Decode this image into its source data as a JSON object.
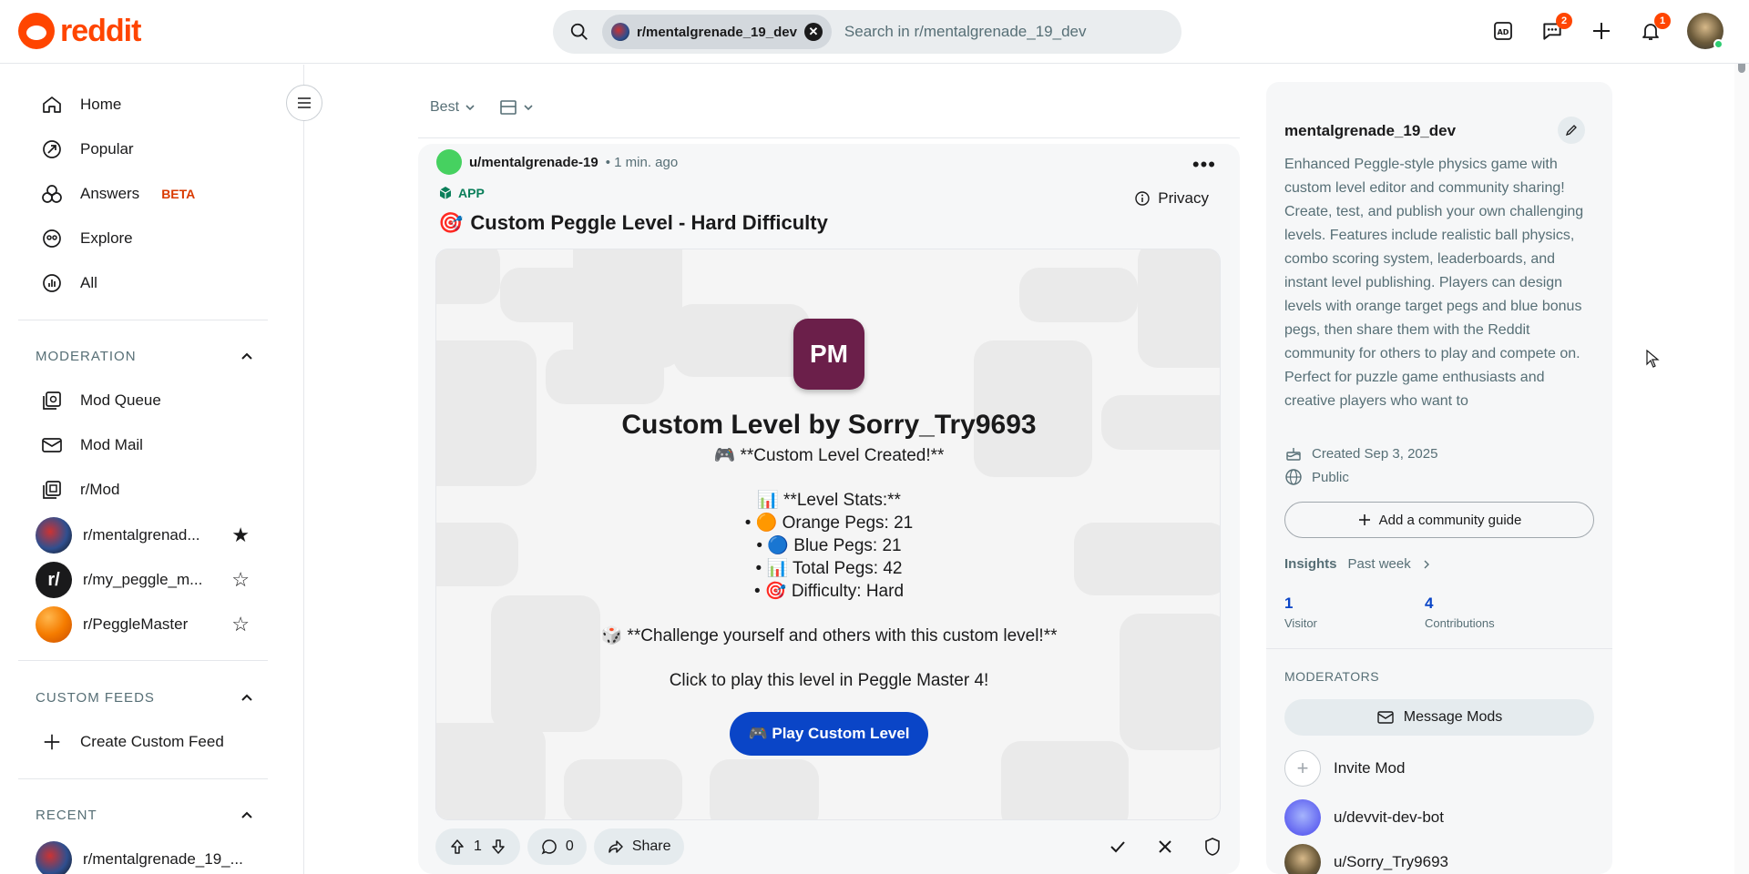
{
  "app": {
    "logo_text": "reddit",
    "brand_color": "#ff4500"
  },
  "search": {
    "chip_label": "r/mentalgrenade_19_dev",
    "placeholder": "Search in r/mentalgrenade_19_dev"
  },
  "header": {
    "chat_badge": "2",
    "notif_badge": "1",
    "icons": [
      "advertise-icon",
      "chat-icon",
      "create-icon",
      "notification-icon"
    ]
  },
  "sidebar": {
    "nav": [
      {
        "label": "Home",
        "icon": "home-icon"
      },
      {
        "label": "Popular",
        "icon": "popular-icon"
      },
      {
        "label": "Answers",
        "icon": "answers-icon",
        "tag": "BETA"
      },
      {
        "label": "Explore",
        "icon": "explore-icon"
      },
      {
        "label": "All",
        "icon": "all-icon"
      }
    ],
    "moderation_title": "MODERATION",
    "moderation": [
      {
        "label": "Mod Queue",
        "icon": "mod-queue-icon"
      },
      {
        "label": "Mod Mail",
        "icon": "mod-mail-icon"
      },
      {
        "label": "r/Mod",
        "icon": "mod-icon"
      }
    ],
    "communities": [
      {
        "label": "r/mentalgrenad...",
        "starred": true
      },
      {
        "label": "r/my_peggle_m...",
        "starred": false
      },
      {
        "label": "r/PeggleMaster",
        "starred": false
      }
    ],
    "custom_feeds_title": "CUSTOM FEEDS",
    "create_feed": "Create Custom Feed",
    "recent_title": "RECENT",
    "recent": [
      {
        "label": "r/mentalgrenade_19_..."
      }
    ]
  },
  "feed": {
    "sort_label": "Best"
  },
  "post": {
    "author": "u/mentalgrenade-19",
    "time": "• 1 min. ago",
    "app_tag": "APP",
    "privacy_label": "Privacy",
    "title": "Custom Peggle Level - Hard Difficulty",
    "embed": {
      "badge": "PM",
      "heading": "Custom Level by Sorry_Try9693",
      "created": "🎮 **Custom Level Created!**",
      "stats_title": "📊 **Level Stats:**",
      "orange": "• 🟠 Orange Pegs: 21",
      "blue": "• 🔵 Blue Pegs: 21",
      "total": "• 📊 Total Pegs: 42",
      "difficulty": "• 🎯 Difficulty: Hard",
      "challenge": "🎲 **Challenge yourself and others with this custom level!**",
      "click_note": "Click to play this level in Peggle Master 4!",
      "play_button": "🎮 Play Custom Level"
    },
    "votes": "1",
    "comments": "0",
    "share_label": "Share"
  },
  "community": {
    "name": "mentalgrenade_19_dev",
    "description": "Enhanced Peggle-style physics game with custom level editor and community sharing! Create, test, and publish your own challenging levels. Features include realistic ball physics, combo scoring system, leaderboards, and instant level publishing. Players can design levels with orange target pegs and blue bonus pegs, then share them with the Reddit community for others to play and compete on. Perfect for puzzle game enthusiasts and creative players who want to",
    "created": "Created Sep 3, 2025",
    "visibility": "Public",
    "guide_button": "Add a community guide",
    "insights_label": "Insights",
    "insights_period": "Past week",
    "visitors": "1",
    "visitors_label": "Visitor",
    "contributions": "4",
    "contributions_label": "Contributions",
    "moderators_title": "MODERATORS",
    "message_mods": "Message Mods",
    "invite_mod": "Invite Mod",
    "mods": [
      "u/devvit-dev-bot",
      "u/Sorry_Try9693"
    ]
  }
}
